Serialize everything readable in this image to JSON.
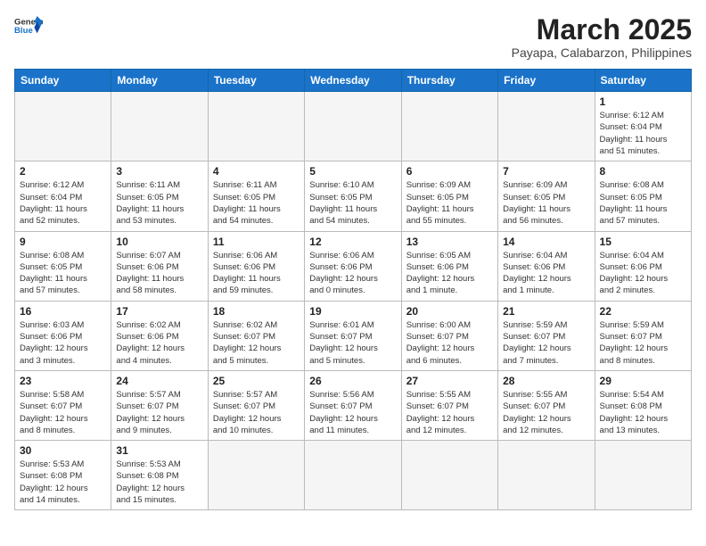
{
  "header": {
    "logo_line1": "General",
    "logo_line2": "Blue",
    "month": "March 2025",
    "location": "Payapa, Calabarzon, Philippines"
  },
  "weekdays": [
    "Sunday",
    "Monday",
    "Tuesday",
    "Wednesday",
    "Thursday",
    "Friday",
    "Saturday"
  ],
  "weeks": [
    [
      {
        "day": "",
        "info": ""
      },
      {
        "day": "",
        "info": ""
      },
      {
        "day": "",
        "info": ""
      },
      {
        "day": "",
        "info": ""
      },
      {
        "day": "",
        "info": ""
      },
      {
        "day": "",
        "info": ""
      },
      {
        "day": "1",
        "info": "Sunrise: 6:12 AM\nSunset: 6:04 PM\nDaylight: 11 hours\nand 51 minutes."
      }
    ],
    [
      {
        "day": "2",
        "info": "Sunrise: 6:12 AM\nSunset: 6:04 PM\nDaylight: 11 hours\nand 52 minutes."
      },
      {
        "day": "3",
        "info": "Sunrise: 6:11 AM\nSunset: 6:05 PM\nDaylight: 11 hours\nand 53 minutes."
      },
      {
        "day": "4",
        "info": "Sunrise: 6:11 AM\nSunset: 6:05 PM\nDaylight: 11 hours\nand 54 minutes."
      },
      {
        "day": "5",
        "info": "Sunrise: 6:10 AM\nSunset: 6:05 PM\nDaylight: 11 hours\nand 54 minutes."
      },
      {
        "day": "6",
        "info": "Sunrise: 6:09 AM\nSunset: 6:05 PM\nDaylight: 11 hours\nand 55 minutes."
      },
      {
        "day": "7",
        "info": "Sunrise: 6:09 AM\nSunset: 6:05 PM\nDaylight: 11 hours\nand 56 minutes."
      },
      {
        "day": "8",
        "info": "Sunrise: 6:08 AM\nSunset: 6:05 PM\nDaylight: 11 hours\nand 57 minutes."
      }
    ],
    [
      {
        "day": "9",
        "info": "Sunrise: 6:08 AM\nSunset: 6:05 PM\nDaylight: 11 hours\nand 57 minutes."
      },
      {
        "day": "10",
        "info": "Sunrise: 6:07 AM\nSunset: 6:06 PM\nDaylight: 11 hours\nand 58 minutes."
      },
      {
        "day": "11",
        "info": "Sunrise: 6:06 AM\nSunset: 6:06 PM\nDaylight: 11 hours\nand 59 minutes."
      },
      {
        "day": "12",
        "info": "Sunrise: 6:06 AM\nSunset: 6:06 PM\nDaylight: 12 hours\nand 0 minutes."
      },
      {
        "day": "13",
        "info": "Sunrise: 6:05 AM\nSunset: 6:06 PM\nDaylight: 12 hours\nand 1 minute."
      },
      {
        "day": "14",
        "info": "Sunrise: 6:04 AM\nSunset: 6:06 PM\nDaylight: 12 hours\nand 1 minute."
      },
      {
        "day": "15",
        "info": "Sunrise: 6:04 AM\nSunset: 6:06 PM\nDaylight: 12 hours\nand 2 minutes."
      }
    ],
    [
      {
        "day": "16",
        "info": "Sunrise: 6:03 AM\nSunset: 6:06 PM\nDaylight: 12 hours\nand 3 minutes."
      },
      {
        "day": "17",
        "info": "Sunrise: 6:02 AM\nSunset: 6:06 PM\nDaylight: 12 hours\nand 4 minutes."
      },
      {
        "day": "18",
        "info": "Sunrise: 6:02 AM\nSunset: 6:07 PM\nDaylight: 12 hours\nand 5 minutes."
      },
      {
        "day": "19",
        "info": "Sunrise: 6:01 AM\nSunset: 6:07 PM\nDaylight: 12 hours\nand 5 minutes."
      },
      {
        "day": "20",
        "info": "Sunrise: 6:00 AM\nSunset: 6:07 PM\nDaylight: 12 hours\nand 6 minutes."
      },
      {
        "day": "21",
        "info": "Sunrise: 5:59 AM\nSunset: 6:07 PM\nDaylight: 12 hours\nand 7 minutes."
      },
      {
        "day": "22",
        "info": "Sunrise: 5:59 AM\nSunset: 6:07 PM\nDaylight: 12 hours\nand 8 minutes."
      }
    ],
    [
      {
        "day": "23",
        "info": "Sunrise: 5:58 AM\nSunset: 6:07 PM\nDaylight: 12 hours\nand 8 minutes."
      },
      {
        "day": "24",
        "info": "Sunrise: 5:57 AM\nSunset: 6:07 PM\nDaylight: 12 hours\nand 9 minutes."
      },
      {
        "day": "25",
        "info": "Sunrise: 5:57 AM\nSunset: 6:07 PM\nDaylight: 12 hours\nand 10 minutes."
      },
      {
        "day": "26",
        "info": "Sunrise: 5:56 AM\nSunset: 6:07 PM\nDaylight: 12 hours\nand 11 minutes."
      },
      {
        "day": "27",
        "info": "Sunrise: 5:55 AM\nSunset: 6:07 PM\nDaylight: 12 hours\nand 12 minutes."
      },
      {
        "day": "28",
        "info": "Sunrise: 5:55 AM\nSunset: 6:07 PM\nDaylight: 12 hours\nand 12 minutes."
      },
      {
        "day": "29",
        "info": "Sunrise: 5:54 AM\nSunset: 6:08 PM\nDaylight: 12 hours\nand 13 minutes."
      }
    ],
    [
      {
        "day": "30",
        "info": "Sunrise: 5:53 AM\nSunset: 6:08 PM\nDaylight: 12 hours\nand 14 minutes."
      },
      {
        "day": "31",
        "info": "Sunrise: 5:53 AM\nSunset: 6:08 PM\nDaylight: 12 hours\nand 15 minutes."
      },
      {
        "day": "",
        "info": ""
      },
      {
        "day": "",
        "info": ""
      },
      {
        "day": "",
        "info": ""
      },
      {
        "day": "",
        "info": ""
      },
      {
        "day": "",
        "info": ""
      }
    ]
  ]
}
